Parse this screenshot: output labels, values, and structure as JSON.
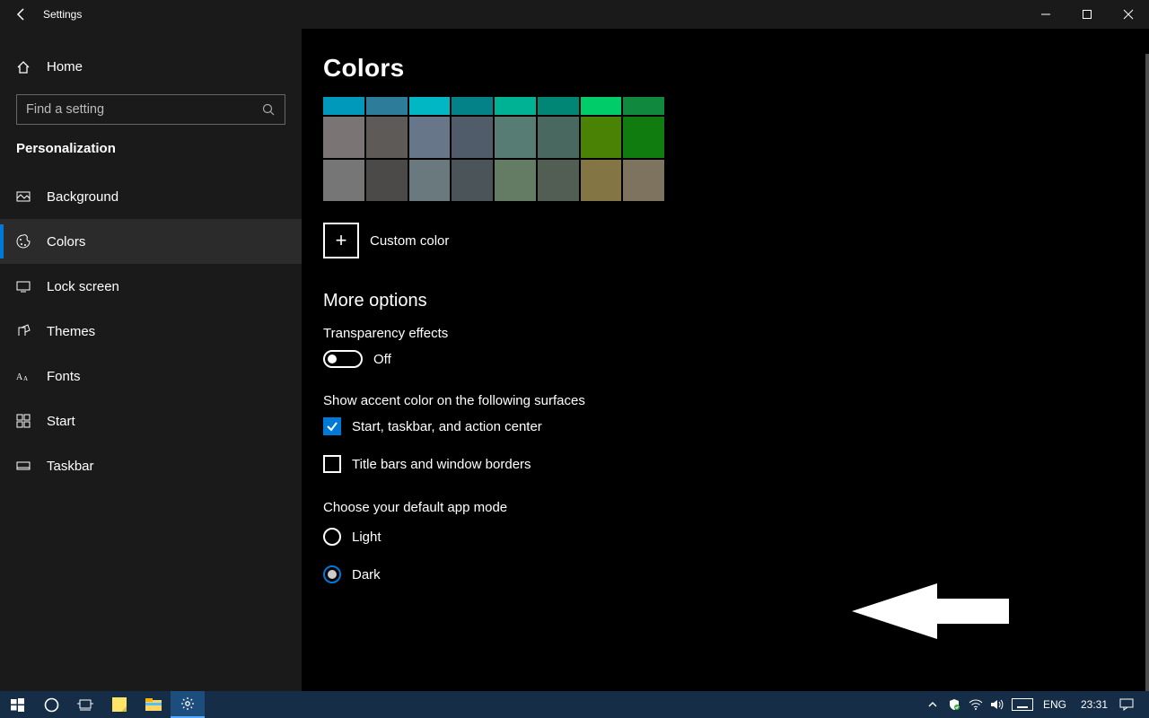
{
  "title": "Settings",
  "home_label": "Home",
  "search_placeholder": "Find a setting",
  "category": "Personalization",
  "nav": [
    {
      "label": "Background"
    },
    {
      "label": "Colors"
    },
    {
      "label": "Lock screen"
    },
    {
      "label": "Themes"
    },
    {
      "label": "Fonts"
    },
    {
      "label": "Start"
    },
    {
      "label": "Taskbar"
    }
  ],
  "page": {
    "title": "Colors",
    "swatch_rows": [
      [
        "#0099bc",
        "#2d7d9a",
        "#00b7c3",
        "#038387",
        "#00b294",
        "#018574",
        "#00cc6a",
        "#10893e"
      ],
      [
        "#7a7574",
        "#5d5a58",
        "#68768a",
        "#515c6b",
        "#567c73",
        "#486860",
        "#498205",
        "#107c10"
      ],
      [
        "#767676",
        "#4c4a48",
        "#69797e",
        "#4a5459",
        "#647c64",
        "#525e54",
        "#847545",
        "#7e735f"
      ]
    ],
    "custom_color": "Custom color",
    "more_options": "More options",
    "transparency_label": "Transparency effects",
    "transparency_state": "Off",
    "accent_surfaces_label": "Show accent color on the following surfaces",
    "check_start": "Start, taskbar, and action center",
    "check_titlebars": "Title bars and window borders",
    "app_mode_label": "Choose your default app mode",
    "radio_light": "Light",
    "radio_dark": "Dark"
  },
  "taskbar": {
    "lang": "ENG",
    "time": "23:31"
  }
}
